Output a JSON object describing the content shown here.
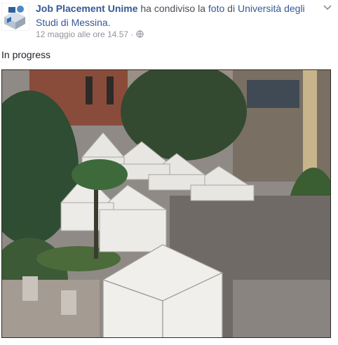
{
  "post": {
    "author": "Job Placement Unime",
    "action_text_1": " ha condiviso la ",
    "shared_object": "foto",
    "action_text_2": " di ",
    "page_name": "Università degli Studi di Messina",
    "action_text_3": ".",
    "timestamp": "12 maggio alle ore 14.57",
    "separator": "·",
    "privacy_icon": "globe-icon",
    "menu_icon": "chevron-down-icon",
    "caption": "In progress"
  },
  "colors": {
    "link": "#365899",
    "meta": "#90949c",
    "text": "#1d2129"
  }
}
